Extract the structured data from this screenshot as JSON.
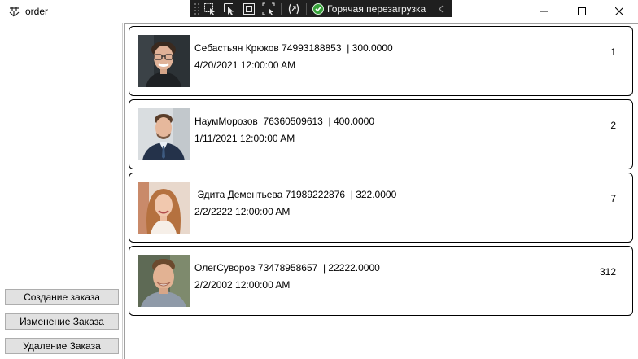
{
  "window": {
    "title": "order",
    "app_icon": "app-icon",
    "controls": [
      "minimize-icon",
      "maximize-icon",
      "close-icon"
    ]
  },
  "debug_toolbar": {
    "tools": [
      "select-element-icon",
      "pointer-icon",
      "display-layout-icon",
      "track-focus-icon",
      "binding-icon"
    ],
    "hot_reload_label": "Горячая перезагрузка",
    "colors": {
      "background": "#1f1f1f",
      "ok": "#37a23a"
    }
  },
  "sidebar": {
    "buttons": [
      {
        "label": "Создание заказа"
      },
      {
        "label": "Изменение Заказа"
      },
      {
        "label": "Удаление Заказа"
      }
    ]
  },
  "orders": [
    {
      "line1": "Себастьян Крюков 74993188853  | 300.0000",
      "line2": "4/20/2021 12:00:00 AM",
      "number": "1",
      "photo": "avatar-man-glasses"
    },
    {
      "line1": "НаумМорозов  76360509613  | 400.0000",
      "line2": "1/11/2021 12:00:00 AM",
      "number": "2",
      "photo": "avatar-man-suit"
    },
    {
      "line1": " Эдита Дементьева 71989222876  | 322.0000",
      "line2": "2/2/2222 12:00:00 AM",
      "number": "7",
      "photo": "avatar-woman"
    },
    {
      "line1": "ОлегСуворов 73478958657  | 22222.0000",
      "line2": "2/2/2002 12:00:00 AM",
      "number": "312",
      "photo": "avatar-man-smiling"
    }
  ]
}
